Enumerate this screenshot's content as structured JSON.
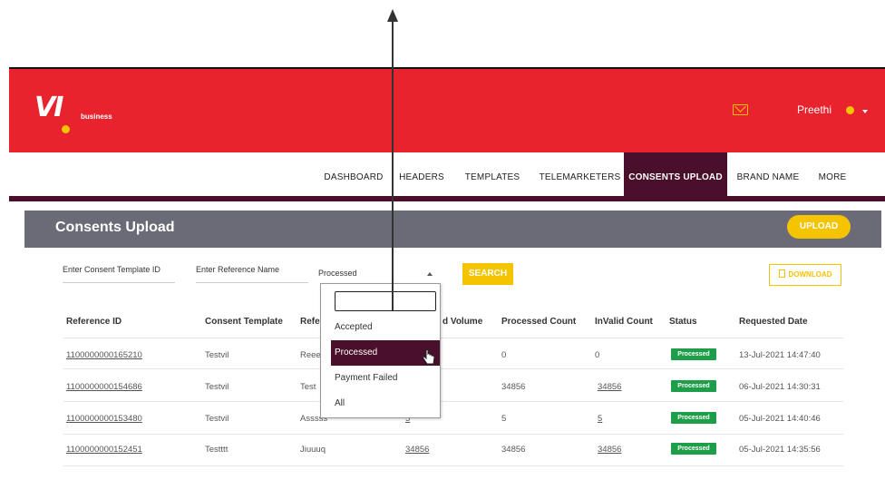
{
  "header": {
    "logo_text": "VI",
    "logo_sub": "business",
    "user_name": "Preethi"
  },
  "nav": {
    "items": [
      "DASHBOARD",
      "HEADERS",
      "TEMPLATES",
      "TELEMARKETERS",
      "CONSENTS UPLOAD",
      "BRAND NAME",
      "MORE"
    ],
    "active": "CONSENTS UPLOAD"
  },
  "page": {
    "title": "Consents Upload",
    "upload_label": "UPLOAD"
  },
  "filters": {
    "template_placeholder": "Enter Consent Template ID",
    "reference_placeholder": "Enter Reference Name",
    "status_value": "Processed",
    "search_label": "SEARCH",
    "download_label": "DOWNLOAD"
  },
  "dropdown": {
    "search_value": "",
    "options": [
      "Accepted",
      "Processed",
      "Payment Failed",
      "All"
    ],
    "selected": "Processed"
  },
  "table": {
    "headers": [
      "Reference ID",
      "Consent Template",
      "Refe",
      "d Volume",
      "Processed Count",
      "InValid Count",
      "Status",
      "Requested Date"
    ],
    "rows": [
      {
        "ref_id": "1100000000165210",
        "template": "Testvil",
        "ref_name": "Reeeeee",
        "volume": "",
        "processed": "0",
        "invalid": "0",
        "status": "Processed",
        "date": "13-Jul-2021 14:47:40"
      },
      {
        "ref_id": "1100000000154686",
        "template": "Testvil",
        "ref_name": "Test",
        "volume": "",
        "processed": "34856",
        "invalid": "34856",
        "status": "Processed",
        "date": "06-Jul-2021 14:30:31"
      },
      {
        "ref_id": "1100000000153480",
        "template": "Testvil",
        "ref_name": "Asssss",
        "volume": "5",
        "processed": "5",
        "invalid": "5",
        "status": "Processed",
        "date": "05-Jul-2021 14:40:46"
      },
      {
        "ref_id": "1100000000152451",
        "template": "Testttt",
        "ref_name": "Jiuuuq",
        "volume": "34856",
        "processed": "34856",
        "invalid": "34856",
        "status": "Processed",
        "date": "05-Jul-2021 14:35:56"
      }
    ]
  },
  "colors": {
    "brand_red": "#e8232e",
    "brand_maroon": "#4a0f2a",
    "accent_yellow": "#f5c400",
    "status_green": "#1f9e4a"
  }
}
